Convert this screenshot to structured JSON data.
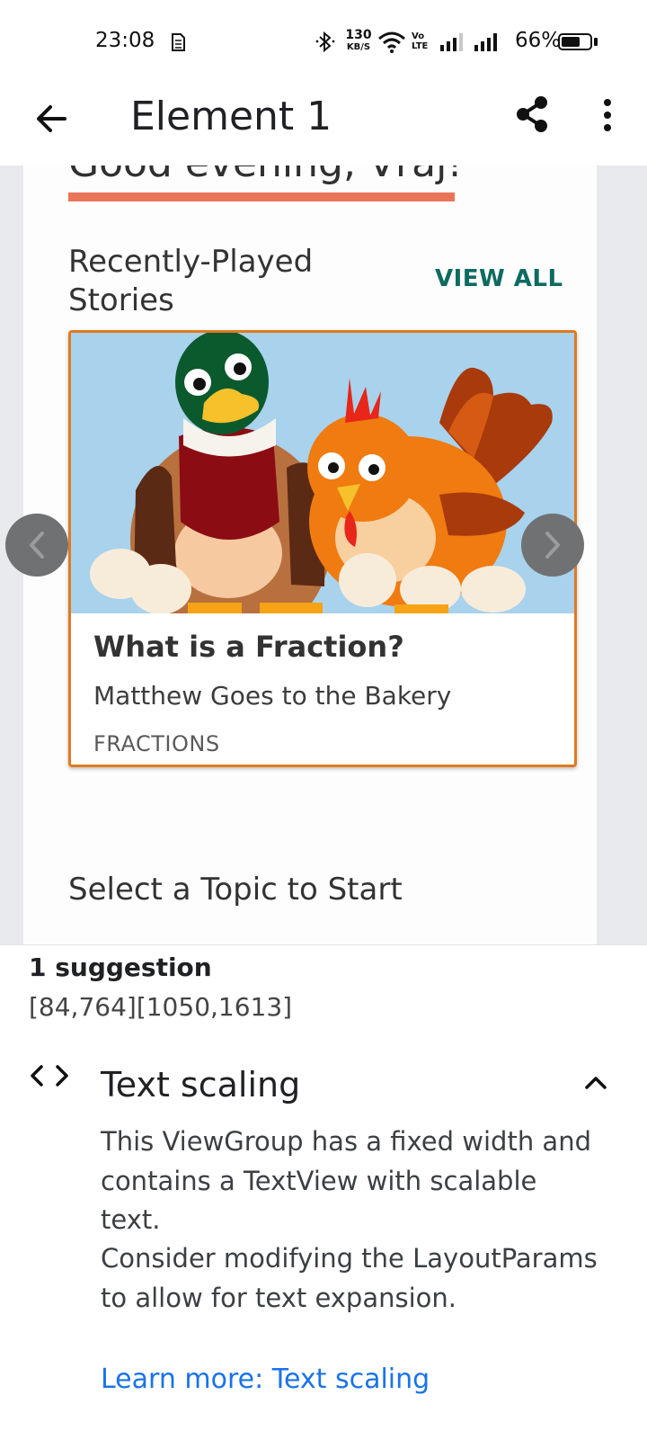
{
  "status_bar": {
    "time": "23:08",
    "network_speed_value": "130",
    "network_speed_unit": "KB/S",
    "volte_label": "Vo LTE",
    "battery_percent": "66%",
    "battery_level": 0.66,
    "icons": [
      "sim-icon",
      "bluetooth-icon",
      "wifi-icon",
      "signal-icon",
      "signal-icon",
      "battery-icon"
    ]
  },
  "app_bar": {
    "title": "Element 1",
    "icons": [
      "back-arrow-icon",
      "share-icon",
      "more-vert-icon"
    ]
  },
  "preview": {
    "greeting": "Good evening, Vraj!",
    "recently_played_title": "Recently-Played Stories",
    "view_all_label": "VIEW ALL",
    "story_card": {
      "title": "What is a Fraction?",
      "subtitle": "Matthew Goes to the Bakery",
      "topic": "FRACTIONS",
      "border_color": "#e07a1f"
    },
    "carousel_icons": [
      "chevron-left-icon",
      "chevron-right-icon"
    ],
    "topic_section_title": "Select a Topic to Start"
  },
  "panel": {
    "suggestion_count": "1 suggestion",
    "bounds": "[84,764][1050,1613]",
    "check": {
      "icon": "code-icon",
      "title": "Text scaling",
      "description_1": "This ViewGroup has a fixed width and contains a TextView with scalable text.",
      "description_2": "Consider modifying the LayoutParams to allow for text expansion.",
      "learn_more_label": "Learn more: Text scaling",
      "collapse_icon": "chevron-up-icon"
    }
  },
  "colors": {
    "accent_teal": "#0d6b60",
    "underline_orange": "#e9765a",
    "link_blue": "#1a73e8",
    "card_border": "#e07a1f"
  }
}
